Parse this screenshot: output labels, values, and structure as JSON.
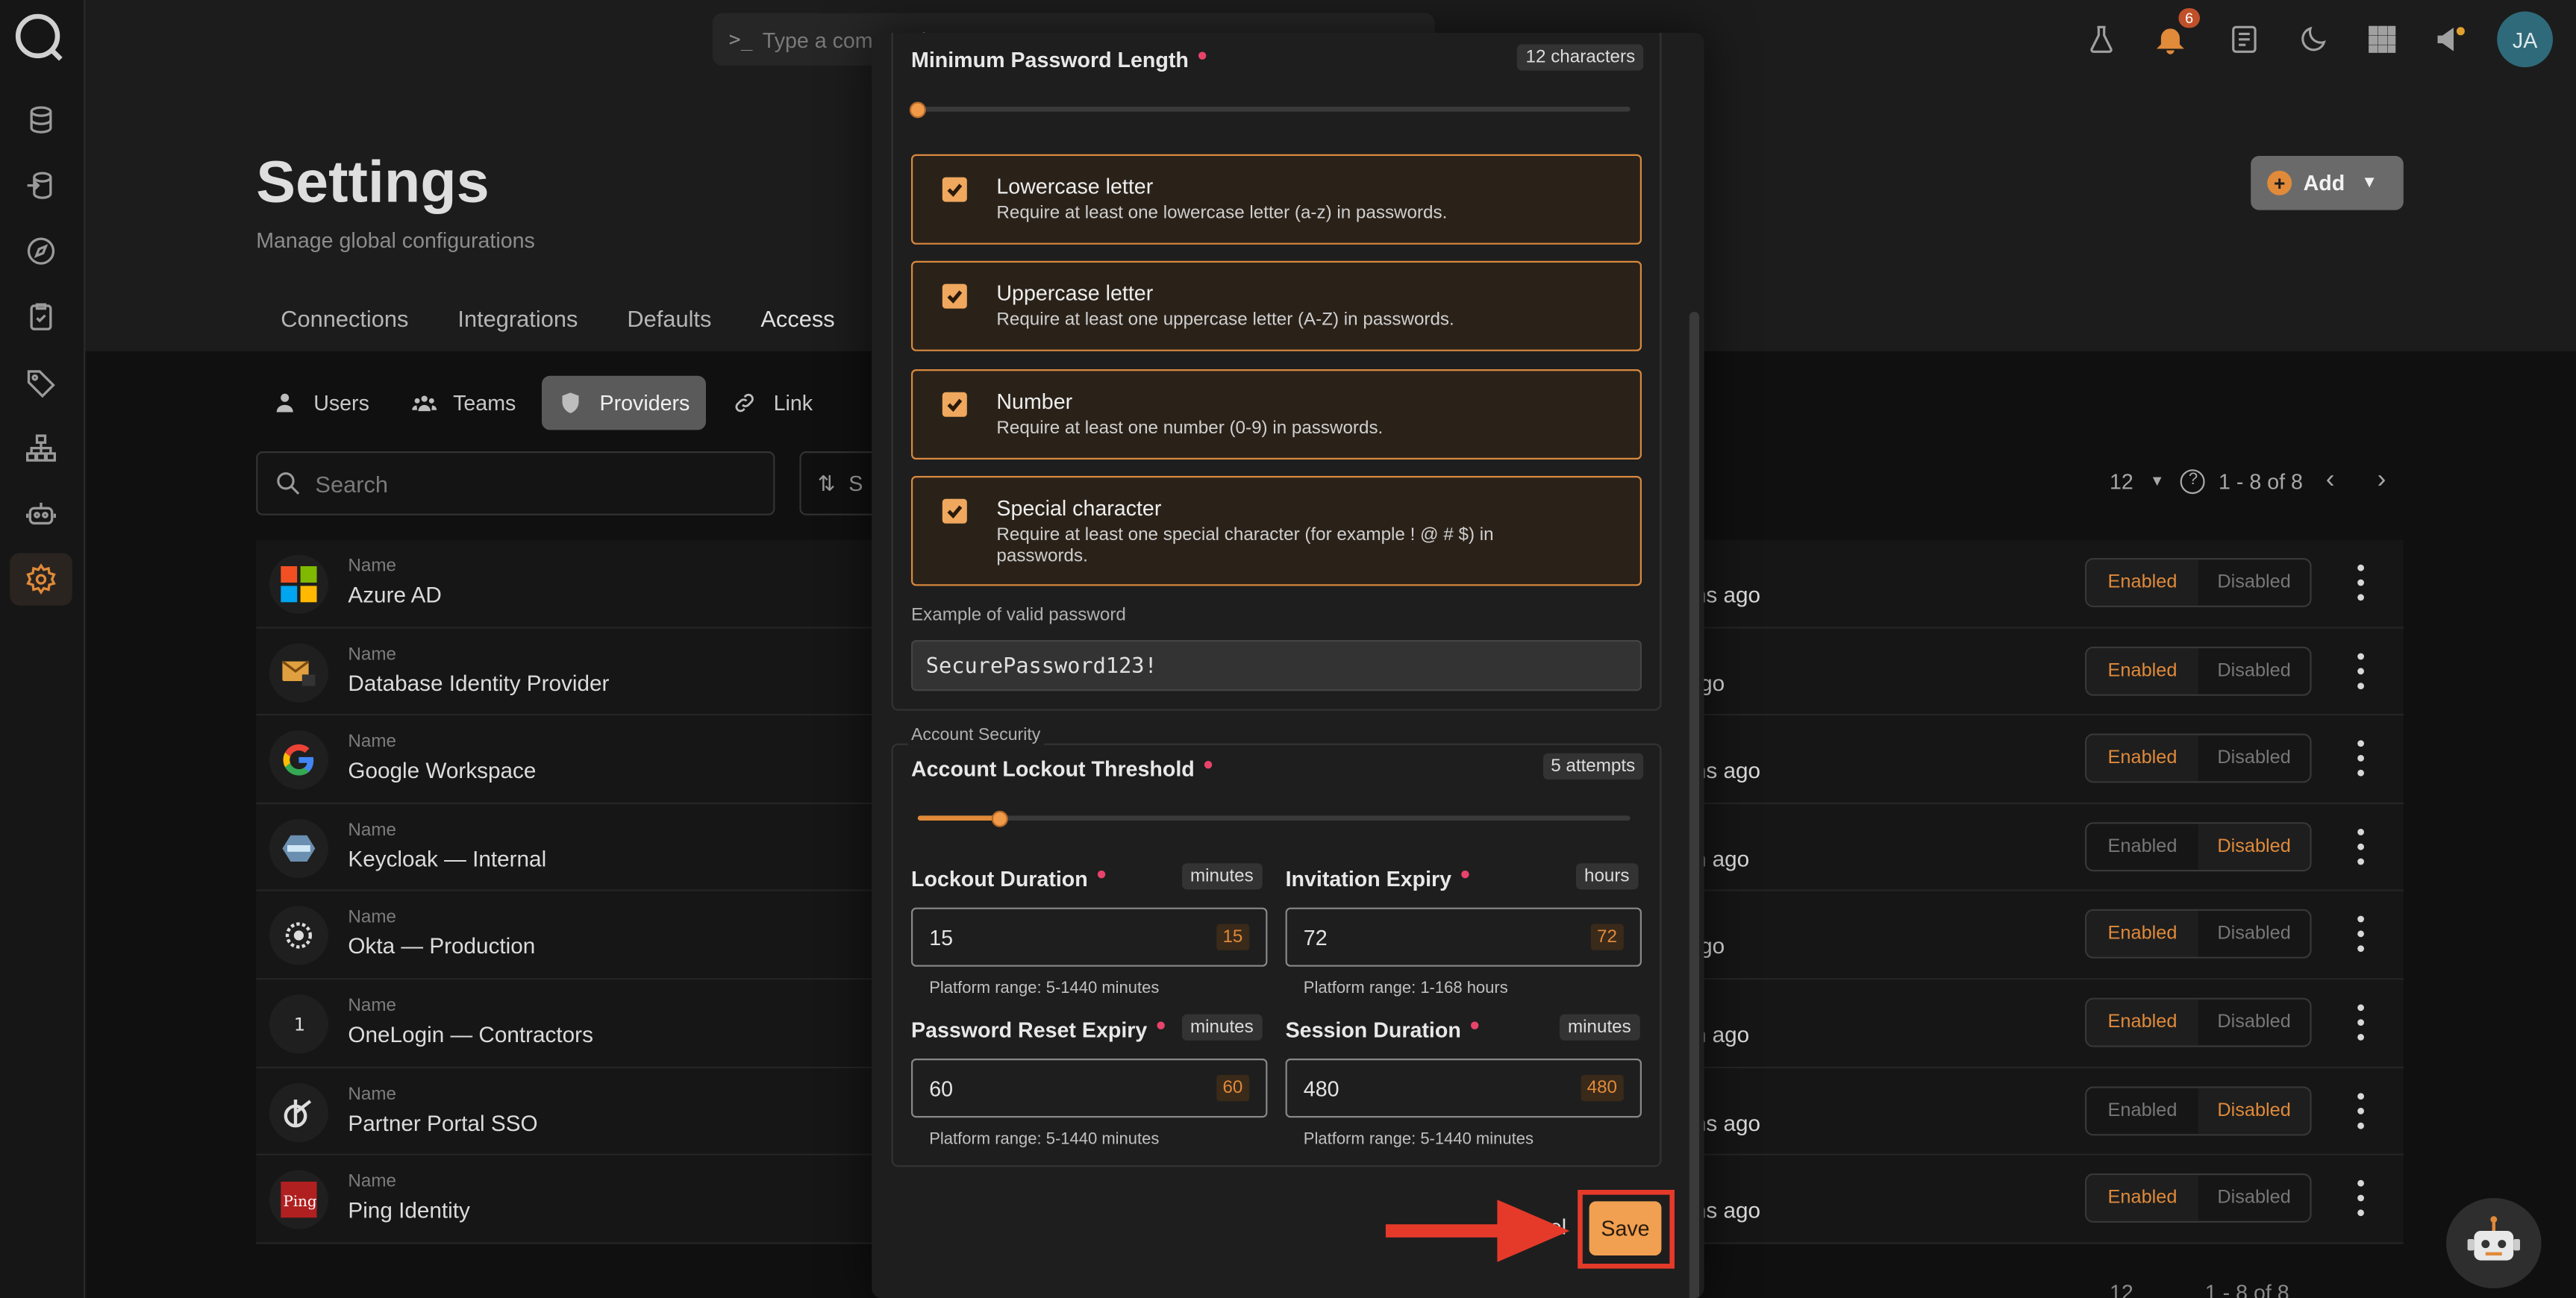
{
  "topbar": {
    "command_placeholder": "Type a command",
    "command_prompt": ">_",
    "notification_count": "6",
    "avatar_initials": "JA"
  },
  "page": {
    "title": "Settings",
    "subtitle": "Manage global configurations",
    "add_label": "Add"
  },
  "tabs": [
    "Connections",
    "Integrations",
    "Defaults",
    "Access"
  ],
  "subtabs": [
    "Users",
    "Teams",
    "Providers",
    "Link"
  ],
  "search": {
    "placeholder": "Search",
    "sort_label": "S"
  },
  "pager": {
    "page_size": "12",
    "range": "1 - 8 of 8"
  },
  "footer_pager": {
    "page_size": "12",
    "range": "1 - 8 of 8"
  },
  "table": {
    "name_label": "Name",
    "enabled_label": "Enabled",
    "disabled_label": "Disabled",
    "rows": [
      {
        "name": "Azure AD",
        "ago": "ths ago",
        "enabled": true
      },
      {
        "name": "Database Identity Provider",
        "ago": "ago",
        "enabled": true
      },
      {
        "name": "Google Workspace",
        "ago": "ths ago",
        "enabled": true
      },
      {
        "name": "Keycloak — Internal",
        "ago": "th ago",
        "enabled": false
      },
      {
        "name": "Okta — Production",
        "ago": "ago",
        "enabled": true
      },
      {
        "name": "OneLogin — Contractors",
        "ago": "th ago",
        "enabled": true
      },
      {
        "name": "Partner Portal SSO",
        "ago": "ths ago",
        "enabled": false
      },
      {
        "name": "Ping Identity",
        "ago": "ths ago",
        "enabled": true
      }
    ]
  },
  "modal": {
    "min_length": {
      "title": "Minimum Password Length",
      "badge": "12 characters",
      "slider_fraction": 0.0
    },
    "checks": [
      {
        "title": "Lowercase letter",
        "desc": "Require at least one lowercase letter (a-z) in passwords.",
        "checked": true
      },
      {
        "title": "Uppercase letter",
        "desc": "Require at least one uppercase letter (A-Z) in passwords.",
        "checked": true
      },
      {
        "title": "Number",
        "desc": "Require at least one number (0-9) in passwords.",
        "checked": true
      },
      {
        "title": "Special character",
        "desc": "Require at least one special character (for example ! @ # $) in passwords.",
        "checked": true
      }
    ],
    "example_label": "Example of valid password",
    "example_value": "SecurePassword123!",
    "account_security_label": "Account Security",
    "lockout_threshold": {
      "title": "Account Lockout Threshold",
      "badge": "5 attempts",
      "slider_fraction": 0.115
    },
    "lockout_duration": {
      "title": "Lockout Duration",
      "unit": "minutes",
      "value": "15",
      "echo": "15",
      "help": "Platform range: 5-1440 minutes"
    },
    "invitation_expiry": {
      "title": "Invitation Expiry",
      "unit": "hours",
      "value": "72",
      "echo": "72",
      "help": "Platform range: 1-168 hours"
    },
    "password_reset_expiry": {
      "title": "Password Reset Expiry",
      "unit": "minutes",
      "value": "60",
      "echo": "60",
      "help": "Platform range: 5-1440 minutes"
    },
    "session_duration": {
      "title": "Session Duration",
      "unit": "minutes",
      "value": "480",
      "echo": "480",
      "help": "Platform range: 5-1440 minutes"
    },
    "cancel_label": "el",
    "save_label": "Save"
  },
  "colors": {
    "accent": "#e08a3a",
    "highlight": "#e53a2a"
  }
}
